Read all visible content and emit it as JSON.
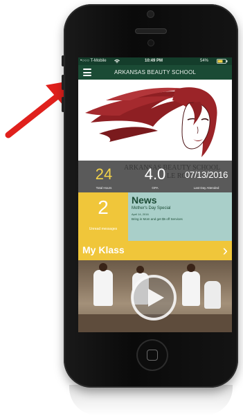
{
  "status_bar": {
    "carrier": "•○○○ T-Mobile",
    "time": "10:49 PM",
    "battery": "54%"
  },
  "nav": {
    "title": "ARKANSAS BEAUTY SCHOOL"
  },
  "hero": {
    "watermark_line1": "ARKANSAS BEAUTY SCHOOL",
    "watermark_line2": "LE RO"
  },
  "stats": [
    {
      "value": "24",
      "label": "Total Hours"
    },
    {
      "value": "4.0",
      "label": "GPA"
    },
    {
      "value": "07/13/2016",
      "label": "Last Day Attended"
    }
  ],
  "messages": {
    "count": "2",
    "label": "Unread messages"
  },
  "news": {
    "heading": "News",
    "item_title": "Mother's Day Special",
    "item_date": "April 14, 2016",
    "item_body": "Bring in Mom and get $5 off Services"
  },
  "klass": {
    "title": "My Klass",
    "chevron": "›"
  },
  "colors": {
    "nav_green": "#1b4b35",
    "accent_yellow": "#f0c63a",
    "news_teal": "#a9cfc9",
    "stats_gray": "#5a5a5a",
    "annotation_red": "#e0201c"
  },
  "icons": [
    "hamburger-menu-icon",
    "wifi-icon",
    "battery-icon",
    "play-icon",
    "chevron-right-icon"
  ]
}
